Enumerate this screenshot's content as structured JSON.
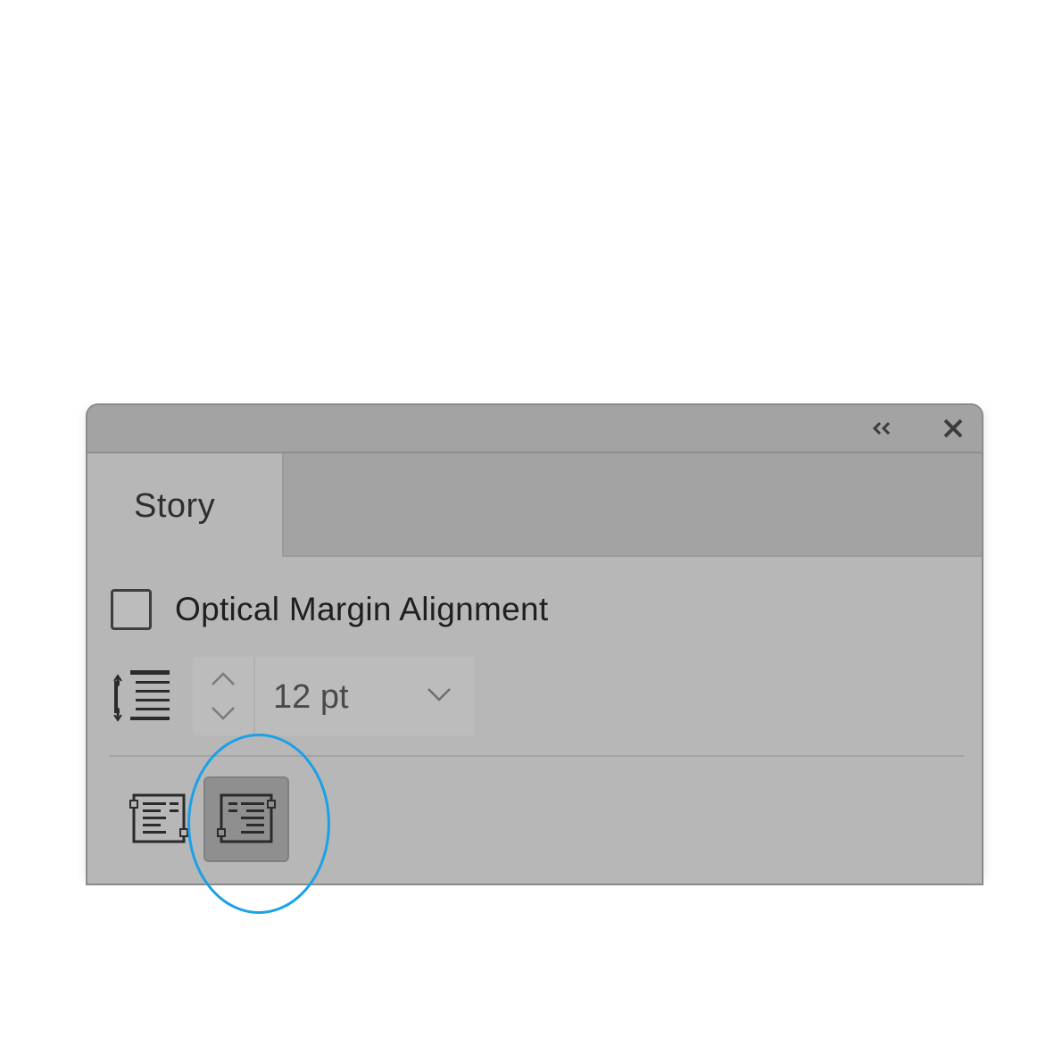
{
  "panel": {
    "title_buttons": {
      "collapse_label": "«",
      "close_label": "✕"
    },
    "tab": {
      "label": "Story"
    },
    "optical_margin": {
      "label": "Optical Margin Alignment",
      "checked": false
    },
    "size": {
      "value": "12 pt",
      "icon": "optical-size-icon",
      "stepper_icon": "stepper-icon",
      "dropdown_icon": "chevron-down-icon"
    },
    "alignment_buttons": [
      {
        "icon": "ignore-optical-margin-left-icon",
        "active": false
      },
      {
        "icon": "ignore-optical-margin-right-icon",
        "active": true
      }
    ]
  },
  "annotation": {
    "highlight_color": "#1aa1e6"
  }
}
